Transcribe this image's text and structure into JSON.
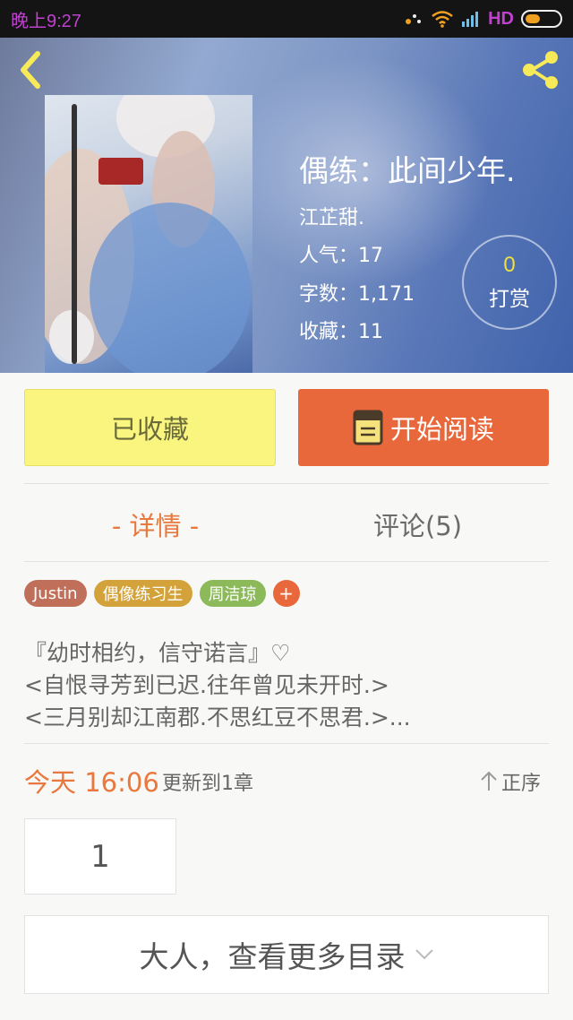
{
  "status_bar": {
    "time": "晚上9:27",
    "network": "HD"
  },
  "book": {
    "title": "偶练：此间少年.",
    "author": "江芷甜.",
    "popularity": "人气：17",
    "word_count": "字数：1,171",
    "favorites": "收藏：11"
  },
  "tip": {
    "count": "0",
    "label": "打赏"
  },
  "actions": {
    "favorite_label": "已收藏",
    "read_label": "开始阅读"
  },
  "tabs": [
    {
      "label": "- 详情 -",
      "active": true
    },
    {
      "label": "评论(5)",
      "active": false
    }
  ],
  "tags": [
    {
      "label": "Justin",
      "color": "#c0705a"
    },
    {
      "label": "偶像练习生",
      "color": "#d4a23a"
    },
    {
      "label": "周洁琼",
      "color": "#8cba5a"
    }
  ],
  "add_tag_label": "+",
  "description": [
    "『幼时相约，信守诺言』♡",
    "<自恨寻芳到已迟.往年曾见未开时.>",
    "<三月别却江南郡.不思红豆不思君.>..."
  ],
  "update": {
    "time": "今天 16:06",
    "text": "更新到1章",
    "order_label": "正序"
  },
  "chapters": [
    "1"
  ],
  "more_catalog_label": "大人，查看更多目录",
  "icons": {
    "back": "chevron-left-icon",
    "share": "share-icon",
    "read": "book-icon",
    "order": "arrow-up-icon",
    "more": "chevron-down-icon"
  },
  "colors": {
    "accent_orange": "#e8683b",
    "favorite_yellow": "#f9f57e",
    "icon_yellow": "#f0e040",
    "tab_active": "#e8783e"
  }
}
